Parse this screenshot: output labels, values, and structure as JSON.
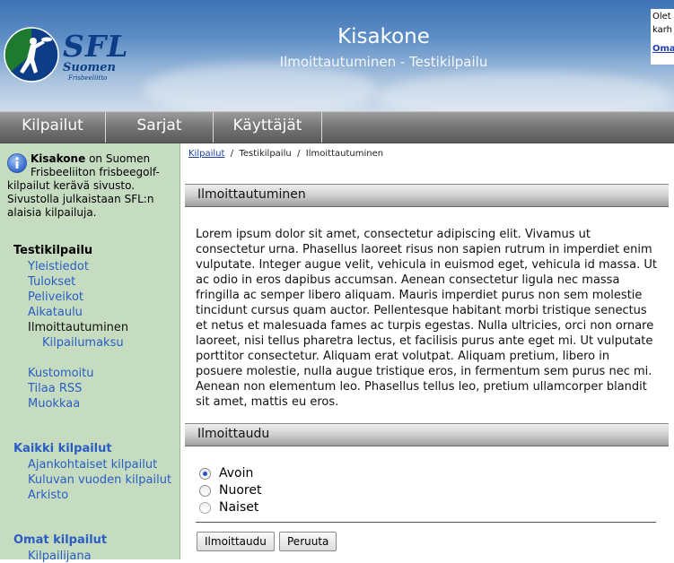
{
  "header": {
    "logo_text": "SFL",
    "logo_sub1": "Suomen",
    "logo_sub2": "Frisbeeliitto",
    "title": "Kisakone",
    "subtitle": "Ilmoittautuminen - Testikilpailu",
    "login_line1": "Olet",
    "login_line2": "karh",
    "login_link": "Omat"
  },
  "nav": {
    "items": [
      {
        "label": "Kilpailut"
      },
      {
        "label": "Sarjat"
      },
      {
        "label": "Käyttäjät"
      }
    ]
  },
  "sidebar": {
    "info_icon": "info-icon",
    "info_bold": "Kisakone",
    "info_text": " on Suomen Frisbeeliiton frisbeegolf-kilpailut kerävä sivusto. Sivustolla julkaistaan SFL:n alaisia kilpailuja.",
    "competition_title": "Testikilpailu",
    "competition_links": [
      "Yleistiedot",
      "Tulokset",
      "Peliveikot",
      "Aikataulu"
    ],
    "current_page": "Ilmoittautuminen",
    "sub_link": "Kilpailumaksu",
    "extra_links": [
      "Kustomoitu",
      "Tilaa RSS",
      "Muokkaa"
    ],
    "all_title": "Kaikki kilpailut",
    "all_links": [
      "Ajankohtaiset kilpailut",
      "Kuluvan vuoden kilpailut",
      "Arkisto"
    ],
    "own_title": "Omat kilpailut",
    "own_links": [
      "Kilpailijana"
    ]
  },
  "breadcrumb": {
    "link": "Kilpailut",
    "sep": "/",
    "item2": "Testikilpailu",
    "item3": "Ilmoittautuminen"
  },
  "main": {
    "section1_title": "Ilmoittautuminen",
    "body_text": "Lorem ipsum dolor sit amet, consectetur adipiscing elit. Vivamus ut consectetur urna. Phasellus laoreet risus non sapien rutrum in imperdiet enim vulputate. Integer augue velit, vehicula in euismod eget, vehicula id massa. Ut ac odio in eros dapibus accumsan. Aenean consectetur ligula nec massa fringilla ac semper libero aliquam. Mauris imperdiet purus non sem molestie tincidunt cursus quam auctor. Pellentesque habitant morbi tristique senectus et netus et malesuada fames ac turpis egestas. Nulla ultricies, orci non ornare laoreet, nisi tellus pharetra lectus, et facilisis purus ante eget mi. Ut vulputate porttitor consectetur. Aliquam erat volutpat. Aliquam pretium, libero in posuere molestie, nulla augue tristique eros, in fermentum sem purus nec mi. Aenean non elementum leo. Phasellus tellus leo, pretium ullamcorper blandit sit amet, mattis eu eros.",
    "section2_title": "Ilmoittaudu",
    "options": [
      {
        "label": "Avoin",
        "selected": true
      },
      {
        "label": "Nuoret",
        "selected": false
      },
      {
        "label": "Naiset",
        "selected": false
      }
    ],
    "register_button": "Ilmoittaudu",
    "cancel_button": "Peruuta"
  },
  "colors": {
    "sidebar_bg": "#c5dcc0",
    "link": "#2b5cc4",
    "logo_blue": "#0d3d86",
    "logo_green": "#1e7a2e"
  }
}
